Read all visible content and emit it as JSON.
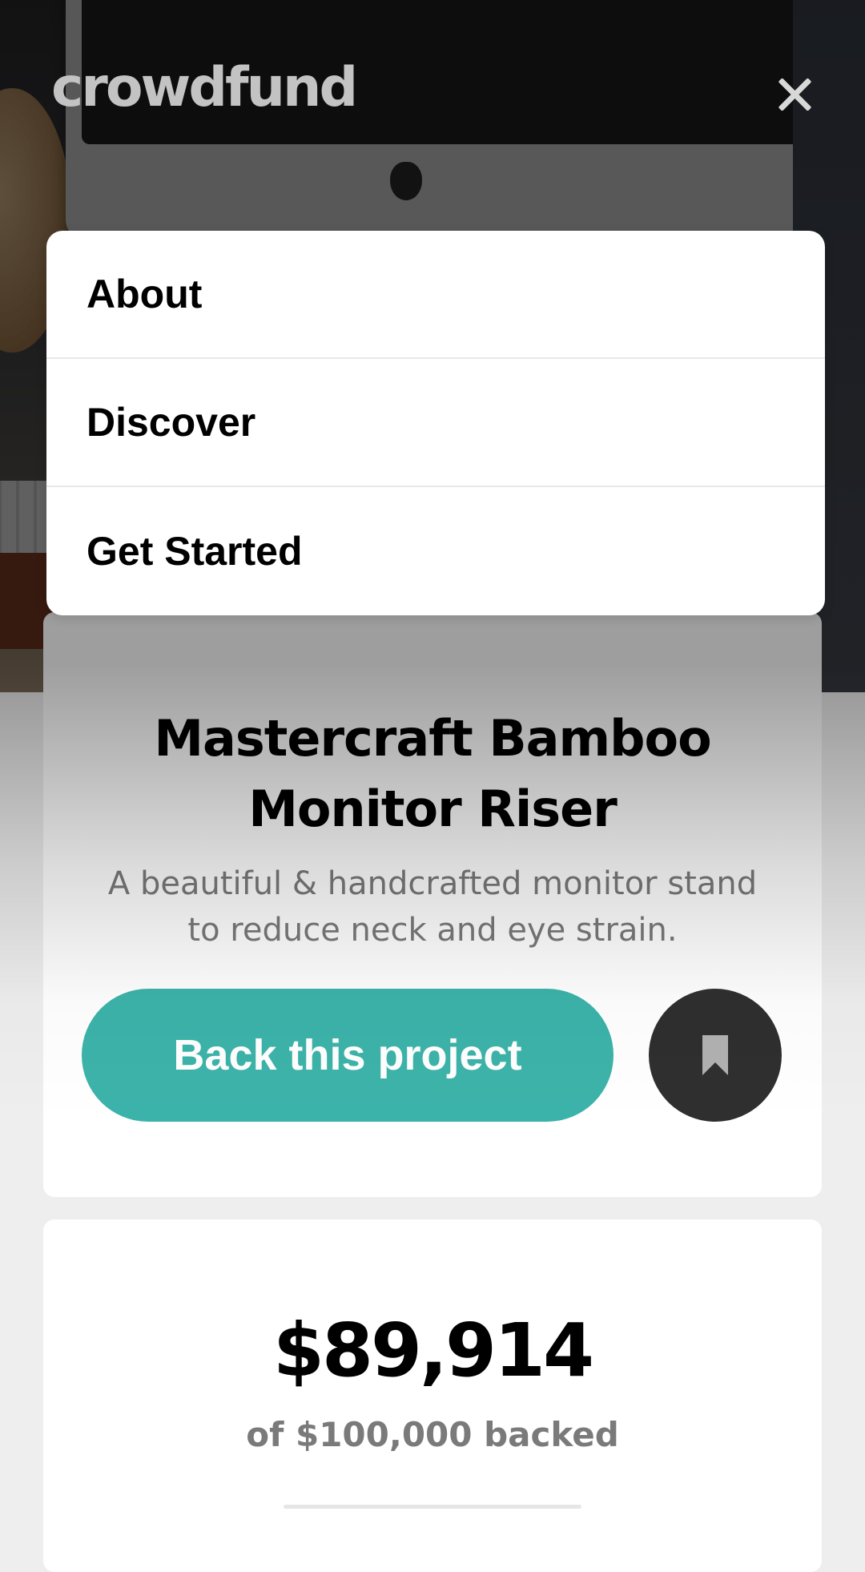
{
  "header": {
    "logo": "crowdfund",
    "close_icon": "close-icon"
  },
  "menu": {
    "items": [
      {
        "label": "About"
      },
      {
        "label": "Discover"
      },
      {
        "label": "Get Started"
      }
    ]
  },
  "project": {
    "title": "Mastercraft Bamboo Monitor Riser",
    "description": "A beautiful & handcrafted monitor stand to reduce neck and eye strain.",
    "back_button_label": "Back this project",
    "bookmark_icon": "bookmark-icon"
  },
  "stats": {
    "amount_backed": "$89,914",
    "goal_text": "of $100,000 backed"
  },
  "colors": {
    "accent": "#3cb3aa",
    "bookmark_bg": "#2f2f2f",
    "text_primary": "#000000",
    "text_muted": "#7a7a7a",
    "page_bg": "#eeeeee"
  }
}
